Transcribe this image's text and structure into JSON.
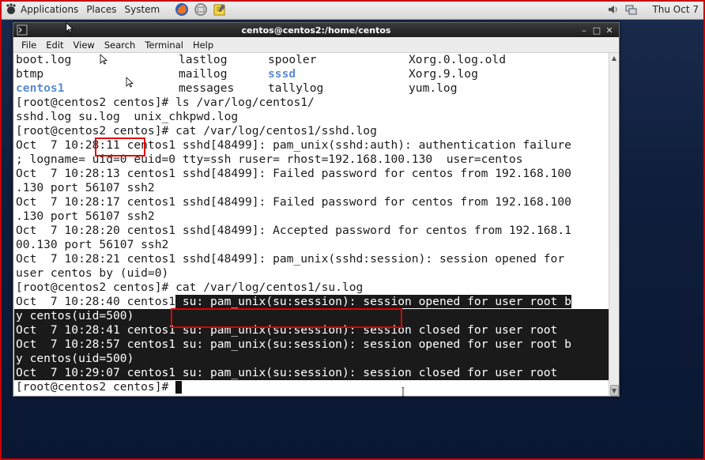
{
  "top_panel": {
    "menus": [
      "Applications",
      "Places",
      "System"
    ],
    "launchers": [
      "firefox-icon",
      "mail-icon",
      "notes-icon"
    ],
    "clock": "Thu Oct  7"
  },
  "window": {
    "title": "centos@centos2:/home/centos",
    "menu": [
      "File",
      "Edit",
      "View",
      "Search",
      "Terminal",
      "Help"
    ]
  },
  "terminal": {
    "ls_rows": [
      [
        "boot.log",
        "lastlog",
        "spooler",
        "Xorg.0.log.old"
      ],
      [
        "btmp",
        "maillog",
        "sssd",
        "Xorg.9.log"
      ],
      [
        "centos1",
        "messages",
        "tallylog",
        "yum.log"
      ]
    ],
    "lines": {
      "l4": "[root@centos2 centos]# ls /var/log/centos1/",
      "l5_a": "sshd.log ",
      "l5_b": "su.log",
      "l5_c": "  unix_chkpwd.log",
      "l6": "[root@centos2 centos]# cat /var/log/centos1/sshd.log",
      "l7": "Oct  7 10:28:11 centos1 sshd[48499]: pam_unix(sshd:auth): authentication failure",
      "l8": "; logname= uid=0 euid=0 tty=ssh ruser= rhost=192.168.100.130  user=centos",
      "l9": "Oct  7 10:28:13 centos1 sshd[48499]: Failed password for centos from 192.168.100",
      "l10": ".130 port 56107 ssh2",
      "l11": "Oct  7 10:28:17 centos1 sshd[48499]: Failed password for centos from 192.168.100",
      "l12": ".130 port 56107 ssh2",
      "l13": "Oct  7 10:28:20 centos1 sshd[48499]: Accepted password for centos from 192.168.1",
      "l14": "00.130 port 56107 ssh2",
      "l15": "Oct  7 10:28:21 centos1 sshd[48499]: pam_unix(sshd:session): session opened for",
      "l16": "user centos by (uid=0)",
      "l17": "[root@centos2 centos]# cat /var/log/centos1/su.log",
      "l18_a": "Oct  7 10:28:40 centos1",
      "l18_b": " su: pam_unix(su:session): session opened for user root b",
      "l19": "y centos(uid=500)",
      "l20": "Oct  7 10:28:41 centos1 su: pam_unix(su:session): session closed for user root",
      "l21": "Oct  7 10:28:57 centos1 su: pam_unix(su:session): session opened for user root b",
      "l22": "y centos(uid=500)",
      "l23": "Oct  7 10:29:07 centos1 su: pam_unix(su:session): session closed for user root",
      "prompt": "[root@centos2 centos]# "
    }
  },
  "colors": {
    "directory": "#5b8bd0",
    "highlight_box": "#e00000",
    "selection_bg": "#1a1a1a"
  }
}
